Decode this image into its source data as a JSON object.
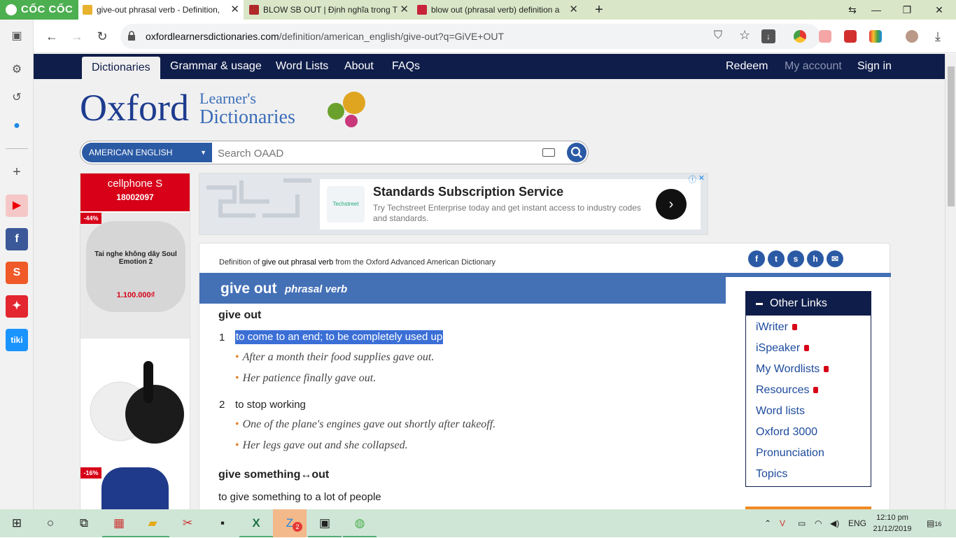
{
  "browser": {
    "name": "CỐC CỐC",
    "tabs": [
      {
        "title": "give-out phrasal verb - Definition,",
        "active": true
      },
      {
        "title": "BLOW SB OUT | Định nghĩa trong T",
        "active": false
      },
      {
        "title": "blow out (phrasal verb) definition a",
        "active": false
      }
    ],
    "new_tab": "+",
    "url_domain": "oxfordlearnersdictionaries.com",
    "url_path": "/definition/american_english/give-out?q=GiVE+OUT"
  },
  "site": {
    "nav": [
      "Dictionaries",
      "Grammar & usage",
      "Word Lists",
      "About",
      "FAQs"
    ],
    "nav_right": [
      "Redeem",
      "My account",
      "Sign in"
    ],
    "logo_main": "Oxford",
    "logo_line1": "Learner's",
    "logo_line2": "Dictionaries",
    "dict_select": "AMERICAN ENGLISH",
    "search_placeholder": "Search OAAD"
  },
  "ads": {
    "left_brand": "cellphone S",
    "left_phone": "18002097",
    "left_sale1": "-44%",
    "left_product": "Tai nghe không dây Soul Emotion 2",
    "left_price": "1.100.000₫",
    "left_sale2": "-16%",
    "top_thumb": "Techstreet",
    "top_title": "Standards Subscription Service",
    "top_desc": "Try Techstreet Enterprise today and get instant access to industry codes and standards."
  },
  "entry": {
    "definition_of_prefix": "Definition of ",
    "definition_of_word": "give out phrasal verb",
    "definition_of_suffix": " from the Oxford Advanced American Dictionary",
    "headword": "give out",
    "pos": "phrasal verb",
    "pv1": "give out",
    "senses": [
      {
        "num": "1",
        "def": "to come to an end; to be completely used up",
        "examples": [
          "After a month their food supplies gave out.",
          "Her patience finally gave out."
        ]
      },
      {
        "num": "2",
        "def": "to stop working",
        "examples": [
          "One of the plane's engines gave out shortly after takeoff.",
          "Her legs gave out and she collapsed."
        ]
      }
    ],
    "pv2": "give something↔out",
    "pv2_def": "to give something to a lot of people"
  },
  "other_links": {
    "title": "Other Links",
    "items": [
      "iWriter",
      "iSpeaker",
      "My Wordlists",
      "Resources",
      "Word lists",
      "Oxford 3000",
      "Pronunciation",
      "Topics"
    ]
  },
  "taskbar": {
    "lang": "ENG",
    "time": "12:10 pm",
    "date": "21/12/2019",
    "notif": "16",
    "zalo_badge": "2"
  }
}
